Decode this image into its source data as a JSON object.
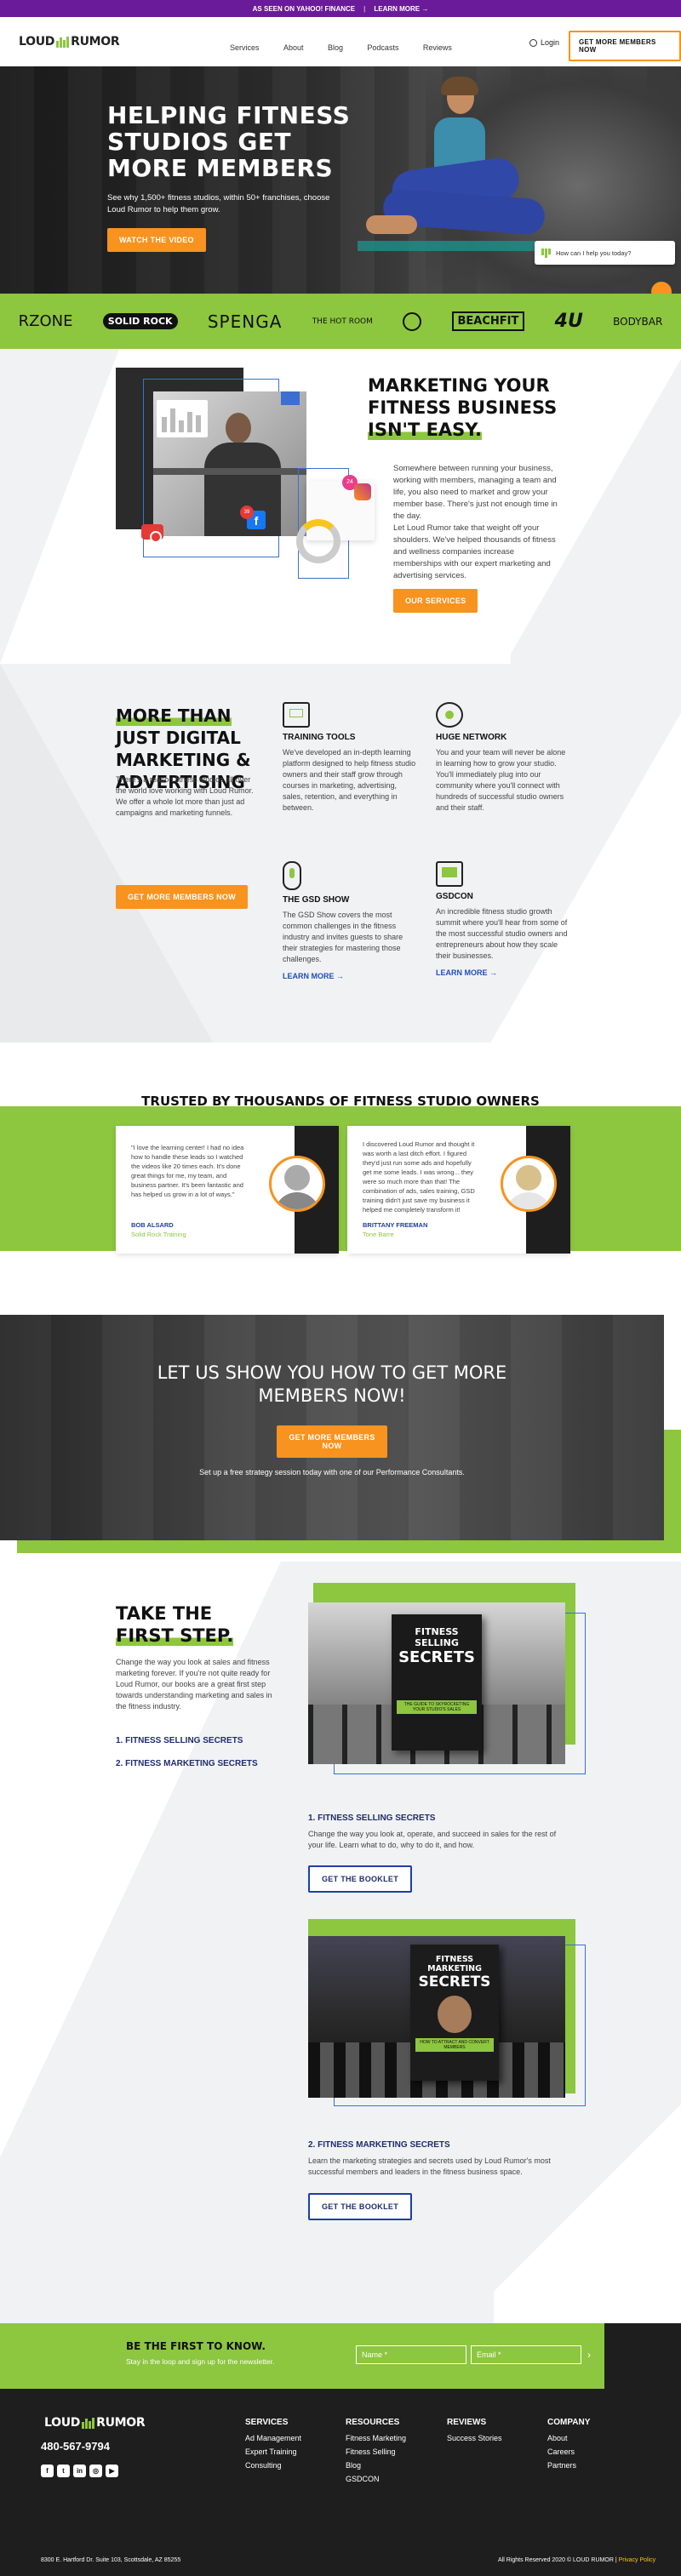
{
  "topbar": {
    "text": "AS SEEN ON YAHOO! FINANCE",
    "link": "LEARN MORE →"
  },
  "nav": {
    "logo_left": "LOUD",
    "logo_right": "RUMOR",
    "links": [
      "Services",
      "About",
      "Blog",
      "Podcasts",
      "Reviews"
    ],
    "login": "Login",
    "cta": "GET MORE MEMBERS NOW"
  },
  "hero": {
    "title": "HELPING FITNESS STUDIOS GET MORE MEMBERS",
    "subtitle": "See why 1,500+ fitness studios, within 50+ franchises, choose Loud Rumor to help them grow.",
    "button": "WATCH THE VIDEO"
  },
  "chat": {
    "text": "How can I help you today?"
  },
  "logos": [
    "RZONE",
    "SOLID ROCK",
    "SPENGA",
    "THE HOT ROOM",
    "",
    "BEACHFIT",
    "4U",
    "BODYBAR"
  ],
  "marketing": {
    "title_1": "MARKETING YOUR",
    "title_2": "FITNESS BUSINESS",
    "title_3": "ISN'T EASY.",
    "p1": "Somewhere between running your business, working with members, managing a team and life, you also need to market and grow your member base. There's just not enough time in the day.",
    "p2": "Let Loud Rumor take that weight off your shoulders. We've helped thousands of fitness and wellness companies increase memberships with our expert marketing and advertising services.",
    "button": "OUR SERVICES",
    "badge_1": "39",
    "badge_2": "24"
  },
  "more": {
    "title_1": "MORE THAN",
    "title_2": "JUST DIGITAL",
    "title_3": "MARKETING &",
    "title_4": "ADVERTISING",
    "p": "There's a reason fitness studios all over the world love working with Loud Rumor. We offer a whole lot more than just ad campaigns and marketing funnels.",
    "button": "GET MORE MEMBERS NOW",
    "features": [
      {
        "title": "TRAINING TOOLS",
        "text": "We've developed an in-depth learning platform designed to help fitness studio owners and their staff grow through courses in marketing, advertising, sales, retention, and everything in between.",
        "link": ""
      },
      {
        "title": "HUGE NETWORK",
        "text": "You and your team will never be alone in learning how to grow your studio. You'll immediately plug into our community where you'll connect with hundreds of successful studio owners and their staff.",
        "link": ""
      },
      {
        "title": "THE GSD SHOW",
        "text": "The GSD Show covers the most common challenges in the fitness industry and invites guests to share their strategies for mastering those challenges.",
        "link": "LEARN MORE →"
      },
      {
        "title": "GSDCON",
        "text": "An incredible fitness studio growth summit where you'll hear from some of the most successful studio owners and entrepreneurs about how they scale their businesses.",
        "link": "LEARN MORE →"
      }
    ]
  },
  "trusted": {
    "title": "TRUSTED BY THOUSANDS OF FITNESS STUDIO OWNERS",
    "testimonials": [
      {
        "quote": "\"I love the learning center! I had no idea how to handle these leads so I watched the videos like 20 times each. It's done great things for me, my team, and business partner. It's been fantastic and has helped us grow in a lot of ways.\"",
        "name": "BOB ALSARD",
        "company": "Solid Rock Training"
      },
      {
        "quote": "I discovered Loud Rumor and thought it was worth a last ditch effort. I figured they'd just run some ads and hopefully get me some leads. I was wrong... they were so much more than that! The combination of ads, sales training, GSD training didn't just save my business it helped me completely transform it!",
        "name": "BRITTANY FREEMAN",
        "company": "Tone Barre"
      }
    ]
  },
  "cta": {
    "title_1": "LET US SHOW YOU HOW TO GET MORE",
    "title_2": "MEMBERS NOW!",
    "button": "GET MORE MEMBERS NOW",
    "sub": "Set up a free strategy session today with one of our Performance Consultants."
  },
  "first": {
    "title_1": "TAKE THE",
    "title_2": "FIRST STEP.",
    "p": "Change the way you look at sales and fitness marketing forever. If you're not quite ready for Loud Rumor, our books are a great first step towards understanding marketing and sales in the fitness industry.",
    "list": [
      "1. FITNESS SELLING SECRETS",
      "2. FITNESS MARKETING SECRETS"
    ],
    "books": [
      {
        "cover_1": "FITNESS SELLING",
        "cover_2": "SECRETS",
        "cover_sub": "THE GUIDE TO SKYROCKETING YOUR STUDIO'S SALES",
        "title": "1. FITNESS SELLING SECRETS",
        "text": "Change the way you look at, operate, and succeed in sales for the rest of your life. Learn what to do, why to do it, and how.",
        "button": "GET THE BOOKLET"
      },
      {
        "cover_1": "FITNESS MARKETING",
        "cover_2": "SECRETS",
        "cover_sub": "HOW TO ATTRACT AND CONVERT MEMBERS",
        "title": "2. FITNESS MARKETING SECRETS",
        "text": "Learn the marketing strategies and secrets used by Loud Rumor's most successful members and leaders in the fitness business space.",
        "button": "GET THE BOOKLET"
      }
    ]
  },
  "newsletter": {
    "title": "BE THE FIRST TO KNOW.",
    "sub": "Stay in the loop and sign up for the newsletter.",
    "name_placeholder": "Name *",
    "email_placeholder": "Email *"
  },
  "footer": {
    "phone": "480-567-9794",
    "address": "8300 E. Hartford Dr. Suite 103, Scottsdale, AZ 85255",
    "copyright": "All Rights Reserved 2020 © LOUD RUMOR |",
    "privacy": "Privacy Policy",
    "cols": [
      {
        "title": "SERVICES",
        "items": [
          "Ad Management",
          "Expert Training",
          "Consulting"
        ]
      },
      {
        "title": "RESOURCES",
        "items": [
          "Fitness Marketing",
          "Fitness Selling",
          "Blog",
          "GSDCON"
        ]
      },
      {
        "title": "REVIEWS",
        "items": [
          "Success Stories"
        ]
      },
      {
        "title": "COMPANY",
        "items": [
          "About",
          "Careers",
          "Partners"
        ]
      }
    ]
  },
  "colors": {
    "green": "#8dc63f",
    "orange": "#f7931e",
    "purple": "#6a1b9a",
    "blue": "#1f3f9f",
    "dark": "#1e1e1e"
  }
}
